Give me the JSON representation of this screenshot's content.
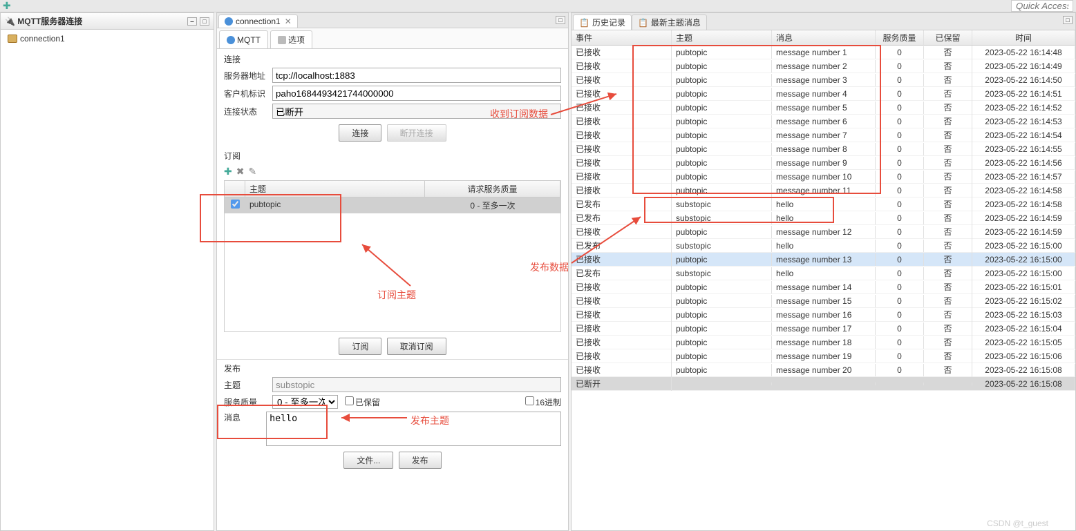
{
  "topbar": {
    "quick_access": "Quick Access"
  },
  "left": {
    "title": "MQTT服务器连接",
    "tree_item": "connection1"
  },
  "editor": {
    "tab_label": "connection1",
    "subtab_mqtt": "MQTT",
    "subtab_opts": "选项"
  },
  "conn": {
    "section": "连接",
    "server_label": "服务器地址",
    "server_value": "tcp://localhost:1883",
    "client_label": "客户机标识",
    "client_value": "paho1684493421744000000",
    "status_label": "连接状态",
    "status_value": "已断开",
    "btn_connect": "连接",
    "btn_disconnect": "断开连接"
  },
  "sub": {
    "section": "订阅",
    "col_topic": "主题",
    "col_qos": "请求服务质量",
    "row_topic": "pubtopic",
    "row_qos": "0 - 至多一次",
    "btn_sub": "订阅",
    "btn_unsub": "取消订阅"
  },
  "pub": {
    "section": "发布",
    "topic_label": "主题",
    "topic_value": "substopic",
    "qos_label": "服务质量",
    "qos_value": "0 - 至多一次",
    "retain_label": "已保留",
    "hex_label": "16进制",
    "msg_label": "消息",
    "msg_value": "hello",
    "btn_file": "文件...",
    "btn_pub": "发布"
  },
  "history": {
    "tab_history": "历史记录",
    "tab_latest": "最新主题消息",
    "cols": {
      "event": "事件",
      "topic": "主题",
      "msg": "消息",
      "qos": "服务质量",
      "retain": "已保留",
      "time": "时间"
    },
    "rows": [
      {
        "e": "已接收",
        "t": "pubtopic",
        "m": "message number 1",
        "q": "0",
        "r": "否",
        "ts": "2023-05-22 16:14:48"
      },
      {
        "e": "已接收",
        "t": "pubtopic",
        "m": "message number 2",
        "q": "0",
        "r": "否",
        "ts": "2023-05-22 16:14:49"
      },
      {
        "e": "已接收",
        "t": "pubtopic",
        "m": "message number 3",
        "q": "0",
        "r": "否",
        "ts": "2023-05-22 16:14:50"
      },
      {
        "e": "已接收",
        "t": "pubtopic",
        "m": "message number 4",
        "q": "0",
        "r": "否",
        "ts": "2023-05-22 16:14:51"
      },
      {
        "e": "已接收",
        "t": "pubtopic",
        "m": "message number 5",
        "q": "0",
        "r": "否",
        "ts": "2023-05-22 16:14:52"
      },
      {
        "e": "已接收",
        "t": "pubtopic",
        "m": "message number 6",
        "q": "0",
        "r": "否",
        "ts": "2023-05-22 16:14:53"
      },
      {
        "e": "已接收",
        "t": "pubtopic",
        "m": "message number 7",
        "q": "0",
        "r": "否",
        "ts": "2023-05-22 16:14:54"
      },
      {
        "e": "已接收",
        "t": "pubtopic",
        "m": "message number 8",
        "q": "0",
        "r": "否",
        "ts": "2023-05-22 16:14:55"
      },
      {
        "e": "已接收",
        "t": "pubtopic",
        "m": "message number 9",
        "q": "0",
        "r": "否",
        "ts": "2023-05-22 16:14:56"
      },
      {
        "e": "已接收",
        "t": "pubtopic",
        "m": "message number 10",
        "q": "0",
        "r": "否",
        "ts": "2023-05-22 16:14:57"
      },
      {
        "e": "已接收",
        "t": "pubtopic",
        "m": "message number 11",
        "q": "0",
        "r": "否",
        "ts": "2023-05-22 16:14:58"
      },
      {
        "e": "已发布",
        "t": "substopic",
        "m": "hello",
        "q": "0",
        "r": "否",
        "ts": "2023-05-22 16:14:58"
      },
      {
        "e": "已发布",
        "t": "substopic",
        "m": "hello",
        "q": "0",
        "r": "否",
        "ts": "2023-05-22 16:14:59"
      },
      {
        "e": "已接收",
        "t": "pubtopic",
        "m": "message number 12",
        "q": "0",
        "r": "否",
        "ts": "2023-05-22 16:14:59"
      },
      {
        "e": "已发布",
        "t": "substopic",
        "m": "hello",
        "q": "0",
        "r": "否",
        "ts": "2023-05-22 16:15:00"
      },
      {
        "e": "已接收",
        "t": "pubtopic",
        "m": "message number 13",
        "q": "0",
        "r": "否",
        "ts": "2023-05-22 16:15:00",
        "sel": true
      },
      {
        "e": "已发布",
        "t": "substopic",
        "m": "hello",
        "q": "0",
        "r": "否",
        "ts": "2023-05-22 16:15:00"
      },
      {
        "e": "已接收",
        "t": "pubtopic",
        "m": "message number 14",
        "q": "0",
        "r": "否",
        "ts": "2023-05-22 16:15:01"
      },
      {
        "e": "已接收",
        "t": "pubtopic",
        "m": "message number 15",
        "q": "0",
        "r": "否",
        "ts": "2023-05-22 16:15:02"
      },
      {
        "e": "已接收",
        "t": "pubtopic",
        "m": "message number 16",
        "q": "0",
        "r": "否",
        "ts": "2023-05-22 16:15:03"
      },
      {
        "e": "已接收",
        "t": "pubtopic",
        "m": "message number 17",
        "q": "0",
        "r": "否",
        "ts": "2023-05-22 16:15:04"
      },
      {
        "e": "已接收",
        "t": "pubtopic",
        "m": "message number 18",
        "q": "0",
        "r": "否",
        "ts": "2023-05-22 16:15:05"
      },
      {
        "e": "已接收",
        "t": "pubtopic",
        "m": "message number 19",
        "q": "0",
        "r": "否",
        "ts": "2023-05-22 16:15:06"
      },
      {
        "e": "已接收",
        "t": "pubtopic",
        "m": "message number 20",
        "q": "0",
        "r": "否",
        "ts": "2023-05-22 16:15:08"
      },
      {
        "e": "已断开",
        "t": "",
        "m": "",
        "q": "",
        "r": "",
        "ts": "2023-05-22 16:15:08",
        "grey": true
      }
    ]
  },
  "anno": {
    "recv": "收到订阅数据",
    "subtopic": "订阅主题",
    "pubtopic": "发布主题",
    "pubdata": "发布数据"
  },
  "watermark": "CSDN @t_guest"
}
